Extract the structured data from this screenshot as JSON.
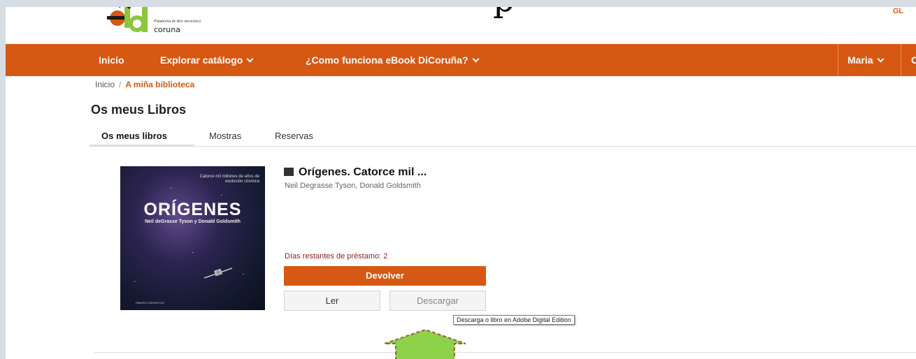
{
  "slide": {
    "title_fragment": "p"
  },
  "header": {
    "logo": {
      "tagline": "Plataforma de libro electrónico",
      "subtext": "coruna"
    },
    "language": "GL"
  },
  "navbar": {
    "home": "Inicio",
    "catalog": "Explorar catálogo",
    "how_it_works": "¿Como funciona eBook DiCoruña?",
    "user": "Maria",
    "extra": "C"
  },
  "breadcrumb": {
    "home": "Inicio",
    "separator": "/",
    "current": "A miña biblioteca"
  },
  "page_title": "Os meus Libros",
  "tabs": [
    {
      "label": "Os meus libros",
      "active": true
    },
    {
      "label": "Mostras",
      "active": false
    },
    {
      "label": "Reservas",
      "active": false
    }
  ],
  "book": {
    "title": "Orígenes. Catorce mil ...",
    "authors": "Neil Degrasse Tyson, Donald Goldsmith",
    "cover": {
      "subtitle": "Catorce mil millones de años de evolución cósmica",
      "big_title": "ORÍGENES",
      "authors": "Neil deGrasse Tyson y Donald Goldsmith",
      "publisher": "PAIDÓS CONTEXTOS"
    },
    "loan_days_label": "Días restantes de préstamo: 2",
    "return_label": "Devolver",
    "read_label": "Ler",
    "download_label": "Descargar",
    "download_tooltip": "Descarga o libro en Adobe Digital Edition"
  },
  "colors": {
    "brand": "#d65812",
    "loan_text": "#8b1d1d",
    "arrow": "#8dd14a"
  }
}
